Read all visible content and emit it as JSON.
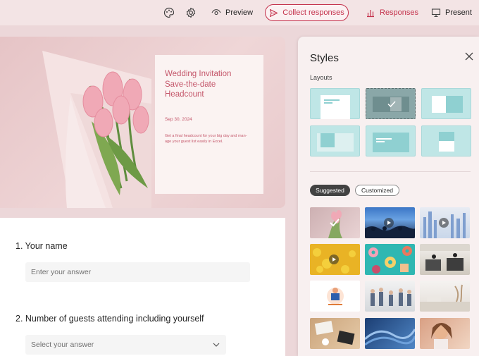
{
  "toolbar": {
    "palette_icon": "palette-icon",
    "settings_icon": "gear-icon",
    "preview_label": "Preview",
    "collect_label": "Collect responses",
    "responses_label": "Responses",
    "present_label": "Present"
  },
  "hero": {
    "title": "Wedding Invitation\nSave-the-date\nHeadcount",
    "date": "Sep 30, 2024",
    "description": "Get a final headcount for your big day and man-\nage your guest list easily in Excel."
  },
  "questions": [
    {
      "label": "1. Your name",
      "placeholder": "Enter your answer"
    },
    {
      "label": "2. Number of guests attending including yourself",
      "placeholder": "Select your answer"
    }
  ],
  "styles_panel": {
    "title": "Styles",
    "layouts_label": "Layouts",
    "selected_layout_index": 1,
    "tabs": {
      "suggested": "Suggested",
      "customized": "Customized"
    },
    "selected_theme_index": 0,
    "theme_names": [
      "tulips-theme",
      "concert-video-theme",
      "blue-buildings-video-theme",
      "yellow-dots-video-theme",
      "donuts-theme",
      "office-theme",
      "illustration-theme",
      "meeting-theme",
      "white-office-theme",
      "desk-theme",
      "blue-waves-theme",
      "smiling-woman-theme"
    ]
  },
  "colors": {
    "accent": "#c4314b",
    "hero_text": "#c4566a",
    "background": "#ecd7d9",
    "layout_tile": "#bfe6e6"
  }
}
